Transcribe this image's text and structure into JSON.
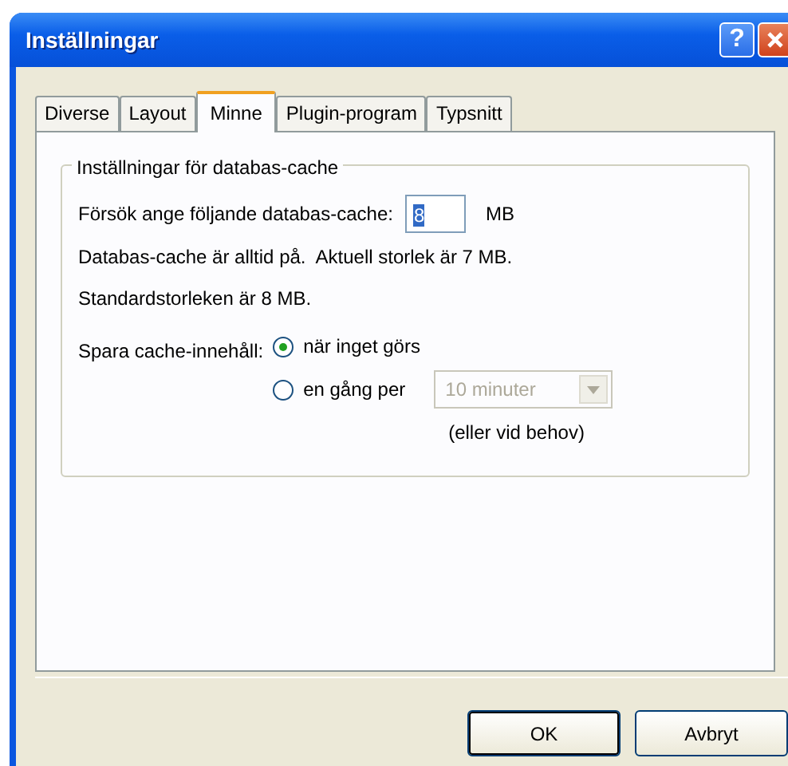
{
  "window": {
    "title": "Inställningar"
  },
  "title_buttons": [
    {
      "kind": "help",
      "label": "?"
    },
    {
      "kind": "close"
    }
  ],
  "tabs": [
    {
      "label": "Diverse",
      "selected": false
    },
    {
      "label": "Layout",
      "selected": false
    },
    {
      "label": "Minne",
      "selected": true
    },
    {
      "label": "Plugin-program",
      "selected": false
    },
    {
      "label": "Typsnitt",
      "selected": false
    }
  ],
  "group": {
    "title": "Inställningar för databas-cache",
    "cache_field": {
      "label": "Försök ange följande databas-cache:",
      "value": "8",
      "text_selected": true,
      "unit": "MB"
    },
    "info": [
      "Databas-cache är alltid på.  Aktuell storlek är 7 MB.",
      "Standardstorleken är 8 MB."
    ],
    "save": {
      "label": "Spara cache-innehåll:",
      "options": [
        {
          "label": "när inget görs",
          "selected": true
        },
        {
          "label": "en gång per",
          "selected": false,
          "dropdown": {
            "value": "10 minuter",
            "disabled": true
          }
        }
      ],
      "note": "(eller vid behov)"
    }
  },
  "buttons": [
    {
      "label": "OK",
      "default": true
    },
    {
      "label": "Avbryt",
      "default": false
    }
  ]
}
